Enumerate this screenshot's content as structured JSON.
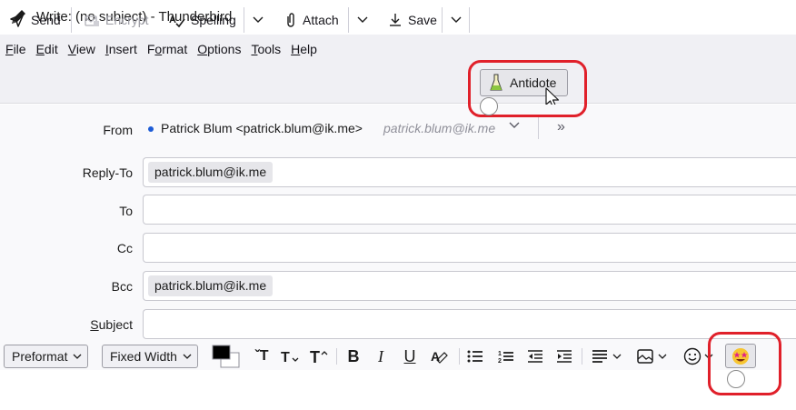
{
  "window": {
    "title": "Write: (no subject) - Thunderbird",
    "icon": "pencil-icon"
  },
  "menubar": {
    "items": [
      {
        "label": "File",
        "mnemonic": "F",
        "rest": "ile"
      },
      {
        "label": "Edit",
        "mnemonic": "E",
        "rest": "dit"
      },
      {
        "label": "View",
        "mnemonic": "V",
        "rest": "iew"
      },
      {
        "label": "Insert",
        "mnemonic": "I",
        "rest": "nsert"
      },
      {
        "label": "Format",
        "prefix": "F",
        "mnemonic": "o",
        "rest": "rmat"
      },
      {
        "label": "Options",
        "mnemonic": "O",
        "rest": "ptions"
      },
      {
        "label": "Tools",
        "mnemonic": "T",
        "rest": "ools"
      },
      {
        "label": "Help",
        "mnemonic": "H",
        "rest": "elp"
      }
    ]
  },
  "toolbar": {
    "send": "Send",
    "encrypt": "Encrypt",
    "spelling": "Spelling",
    "attach": "Attach",
    "save": "Save",
    "antidote": "Antidote"
  },
  "header": {
    "from_label": "From",
    "from_value": "Patrick Blum <patrick.blum@ik.me>",
    "from_alias": "patrick.blum@ik.me",
    "reply_to_label": "Reply-To",
    "reply_to_value": "patrick.blum@ik.me",
    "to_label": "To",
    "cc_label": "Cc",
    "bcc_label": "Bcc",
    "bcc_value": "patrick.blum@ik.me",
    "subject_label": "Subject",
    "subject_value": ""
  },
  "format_toolbar": {
    "paragraph_format": "Preformat",
    "font": "Fixed Width",
    "text_color": "#000000",
    "background_color": "#ffffff"
  },
  "colors": {
    "highlight": "#e0202a",
    "accent_dot": "#1d5cd6"
  }
}
